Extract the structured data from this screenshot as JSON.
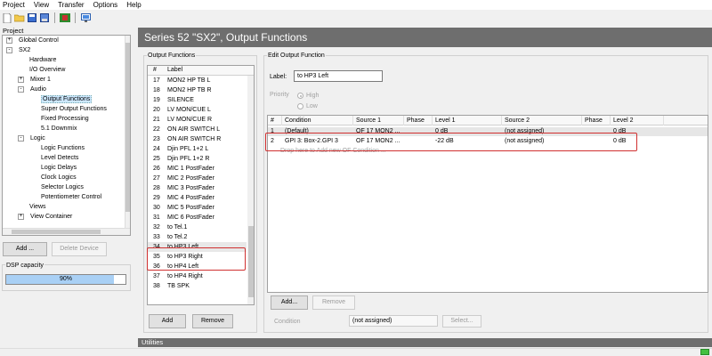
{
  "menu": [
    "Project",
    "View",
    "Transfer",
    "Options",
    "Help"
  ],
  "toolbar": {
    "icons": [
      "new-icon",
      "open-icon",
      "save-icon",
      "save-as-icon",
      "flag-icon",
      "monitor-icon"
    ]
  },
  "project": {
    "title": "Project",
    "tree": [
      {
        "label": "Global Control",
        "level": 1,
        "expander": "+"
      },
      {
        "label": "SX2",
        "level": 1,
        "expander": "-"
      },
      {
        "label": "Hardware",
        "level": 2,
        "expander": ""
      },
      {
        "label": "I/O Overview",
        "level": 2,
        "expander": ""
      },
      {
        "label": "Mixer 1",
        "level": 2,
        "expander": "+"
      },
      {
        "label": "Audio",
        "level": 2,
        "expander": "-"
      },
      {
        "label": "Output Functions",
        "level": 3,
        "expander": "",
        "selected": true
      },
      {
        "label": "Super Output Functions",
        "level": 3,
        "expander": ""
      },
      {
        "label": "Fixed Processing",
        "level": 3,
        "expander": ""
      },
      {
        "label": "5.1 Downmix",
        "level": 3,
        "expander": ""
      },
      {
        "label": "Logic",
        "level": 2,
        "expander": "-"
      },
      {
        "label": "Logic Functions",
        "level": 3,
        "expander": ""
      },
      {
        "label": "Level Detects",
        "level": 3,
        "expander": ""
      },
      {
        "label": "Logic Delays",
        "level": 3,
        "expander": ""
      },
      {
        "label": "Clock Logics",
        "level": 3,
        "expander": ""
      },
      {
        "label": "Selector Logics",
        "level": 3,
        "expander": ""
      },
      {
        "label": "Potentiometer Control",
        "level": 3,
        "expander": ""
      },
      {
        "label": "Views",
        "level": 2,
        "expander": ""
      },
      {
        "label": "View Container",
        "level": 2,
        "expander": "+"
      }
    ],
    "add_button": "Add ...",
    "delete_button": "Delete Device"
  },
  "dsp": {
    "label": "DSP capacity",
    "value_text": "90%",
    "fraction": 0.9
  },
  "main": {
    "title": "Series 52 \"SX2\", Output Functions"
  },
  "output_functions": {
    "title": "Output Functions",
    "col_num": "#",
    "col_label": "Label",
    "rows": [
      {
        "num": "17",
        "label": "MON2 HP TB L"
      },
      {
        "num": "18",
        "label": "MON2 HP TB R"
      },
      {
        "num": "19",
        "label": "SILENCE"
      },
      {
        "num": "20",
        "label": "LV MON/CUE L"
      },
      {
        "num": "21",
        "label": "LV MON/CUE R"
      },
      {
        "num": "22",
        "label": "ON AIR SWITCH L"
      },
      {
        "num": "23",
        "label": "ON AIR SWITCH R"
      },
      {
        "num": "24",
        "label": "Djin PFL 1+2 L"
      },
      {
        "num": "25",
        "label": "Djin PFL 1+2 R"
      },
      {
        "num": "26",
        "label": "MIC 1 PostFader"
      },
      {
        "num": "27",
        "label": "MIC 2 PostFader"
      },
      {
        "num": "28",
        "label": "MIC 3 PostFader"
      },
      {
        "num": "29",
        "label": "MIC 4 PostFader"
      },
      {
        "num": "30",
        "label": "MIC 5 PostFader"
      },
      {
        "num": "31",
        "label": "MIC 6 PostFader"
      },
      {
        "num": "32",
        "label": "to Tel.1"
      },
      {
        "num": "33",
        "label": "to Tel.2"
      },
      {
        "num": "34",
        "label": "to HP3 Left",
        "highlight": true
      },
      {
        "num": "35",
        "label": "to HP3 Right"
      },
      {
        "num": "36",
        "label": "to HP4 Left"
      },
      {
        "num": "37",
        "label": "to HP4 Right"
      },
      {
        "num": "38",
        "label": "TB SPK"
      }
    ],
    "add_button": "Add",
    "remove_button": "Remove"
  },
  "edit": {
    "title": "Edit Output Function",
    "label_caption": "Label:",
    "label_value": "to HP3 Left",
    "priority_caption": "Priority",
    "priority_high": "High",
    "priority_low": "Low",
    "columns": [
      "#",
      "Condition",
      "Source 1",
      "Phase",
      "Level 1",
      "Source 2",
      "Phase",
      "Level 2"
    ],
    "rows": [
      {
        "num": "1",
        "condition": "(Default)",
        "source1": "OF 17 MON2 ...",
        "phase1": "",
        "level1": "0 dB",
        "source2": "(not assigned)",
        "phase2": "",
        "level2": "0 dB"
      },
      {
        "num": "2",
        "condition": "GPI 3: Box-2.GPI 3",
        "source1": "OF 17 MON2 ...",
        "phase1": "",
        "level1": "-22 dB",
        "source2": "(not assigned)",
        "phase2": "",
        "level2": "0 dB"
      }
    ],
    "drop_hint": "Drop here to Add new OF Condition ...",
    "add_button": "Add...",
    "remove_button": "Remove",
    "condition_caption": "Condition",
    "condition_value": "(not assigned)",
    "select_button": "Select..."
  },
  "utilities": {
    "title": "Utilities"
  }
}
